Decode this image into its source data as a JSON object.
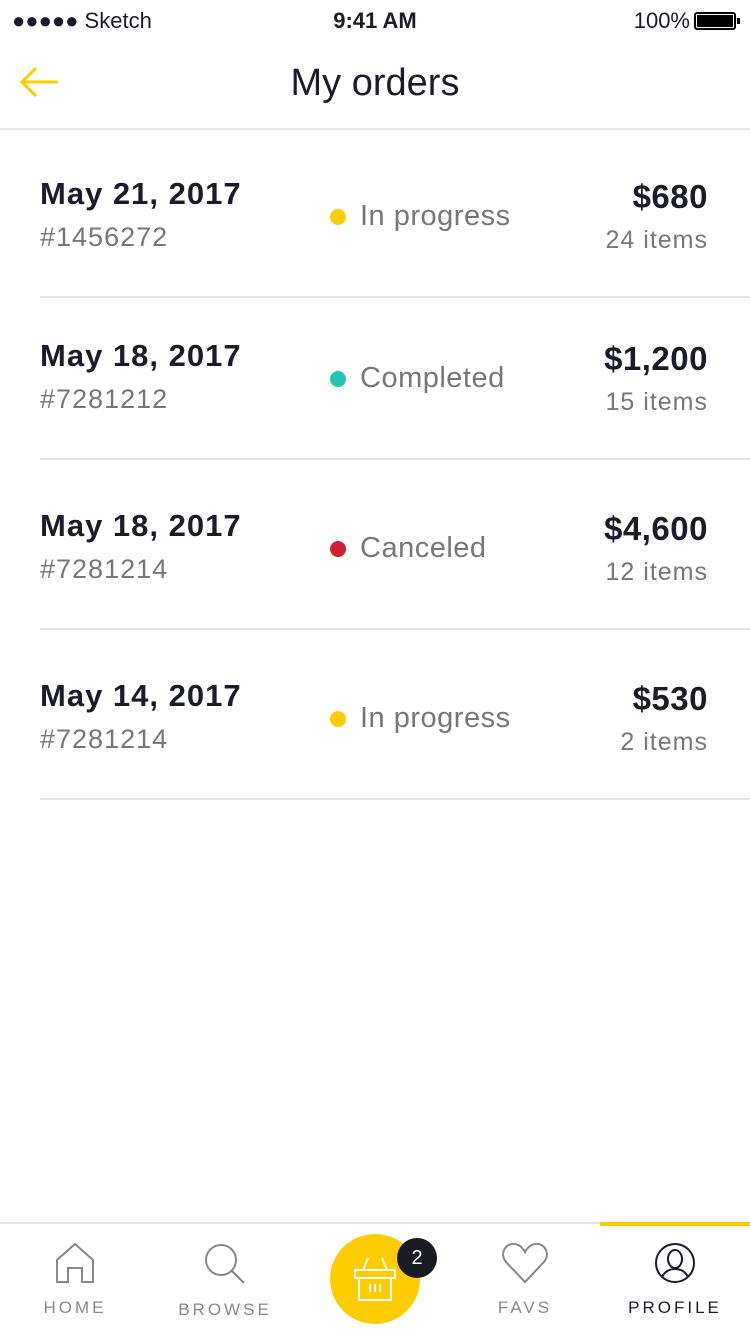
{
  "status": {
    "carrier": "●●●●● Sketch",
    "time": "9:41 AM",
    "battery": "100%"
  },
  "header": {
    "title": "My orders"
  },
  "colors": {
    "accent": "#FFCC00",
    "in_progress": "#FFCC00",
    "completed": "#1FC6B0",
    "canceled": "#D0202E"
  },
  "orders": [
    {
      "date": "May 21, 2017",
      "number": "#1456272",
      "status": "In progress",
      "price": "$680",
      "items": "24 items"
    },
    {
      "date": "May 18, 2017",
      "number": "#7281212",
      "status": "Completed",
      "price": "$1,200",
      "items": "15 items"
    },
    {
      "date": "May 18, 2017",
      "number": "#7281214",
      "status": "Canceled",
      "price": "$4,600",
      "items": "12 items"
    },
    {
      "date": "May 14, 2017",
      "number": "#7281214",
      "status": "In progress",
      "price": "$530",
      "items": "2 items"
    }
  ],
  "tabbar": {
    "home": "HOME",
    "browse": "BROWSE",
    "cart_count": "2",
    "favs": "FAVS",
    "profile": "PROFILE"
  }
}
